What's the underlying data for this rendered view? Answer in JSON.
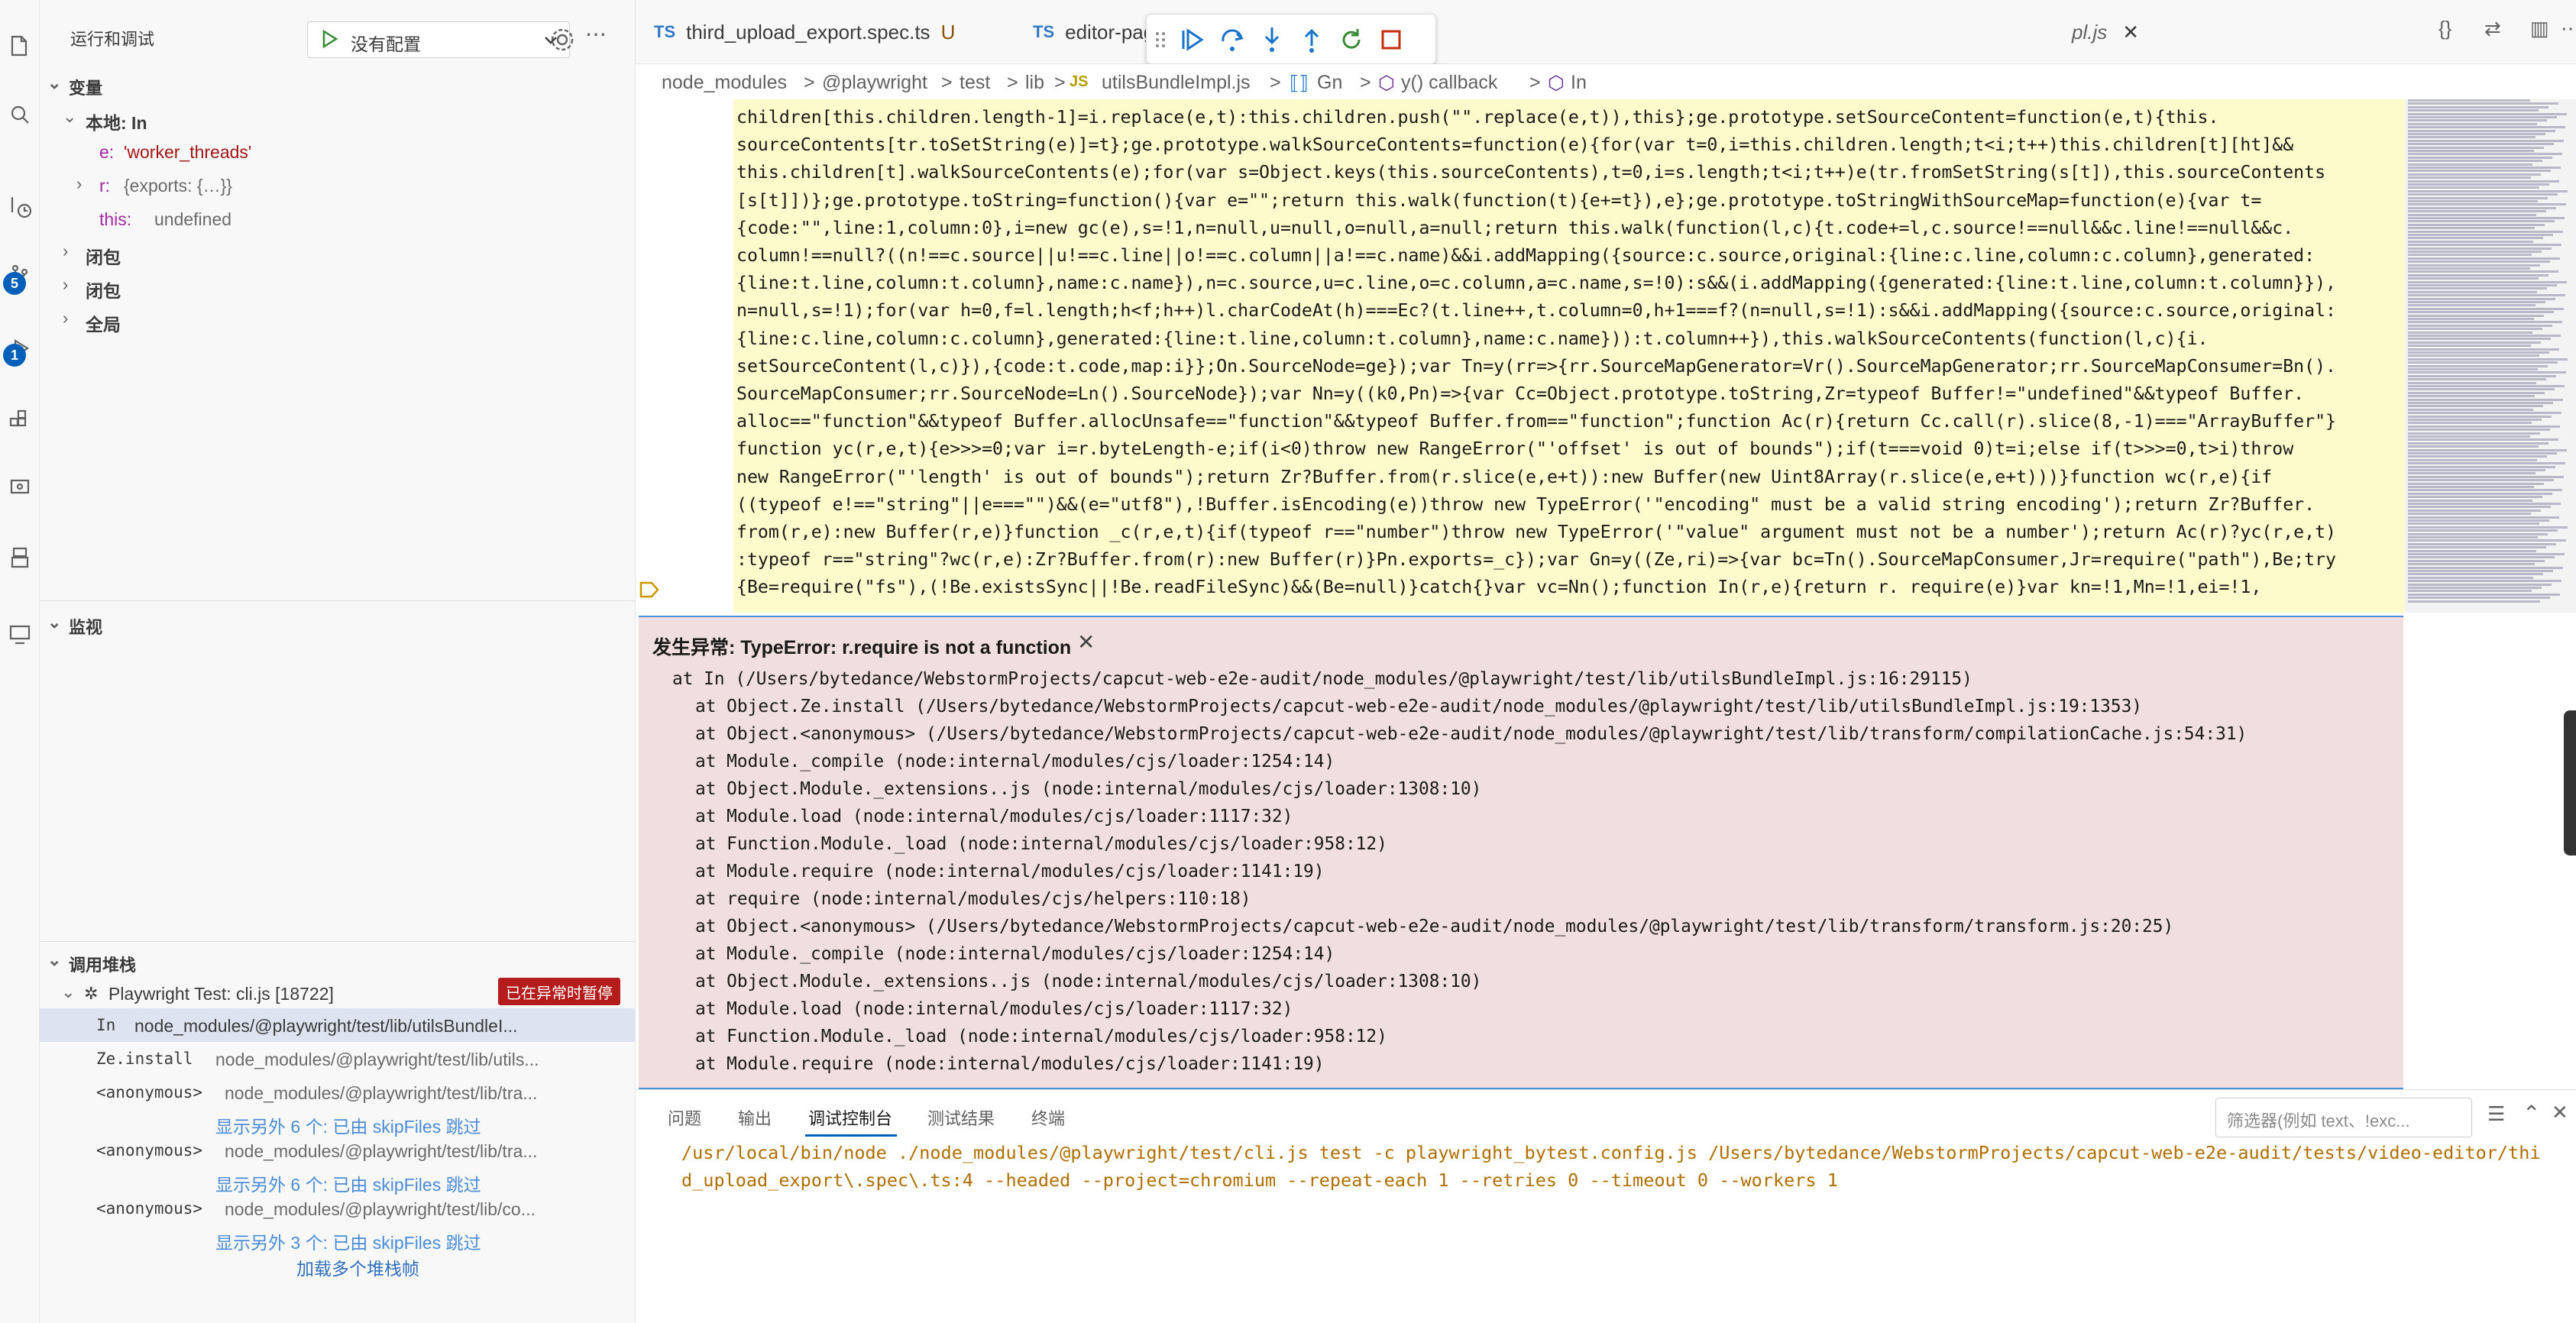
{
  "sidebar": {
    "title": "运行和调试",
    "run_config": "没有配置",
    "variables_header": "变量",
    "local_header": "本地: In",
    "vars": [
      {
        "name": "e:",
        "value": "'worker_threads'"
      },
      {
        "name": "r:",
        "value": "{exports: {…}}"
      },
      {
        "name": "this:",
        "value": "undefined"
      }
    ],
    "closure1": "闭包",
    "closure2": "闭包",
    "global": "全局",
    "watch_header": "监视",
    "callstack_header": "调用堆栈",
    "session": "Playwright Test: cli.js [18722]",
    "paused_badge": "已在异常时暂停",
    "frames": [
      {
        "fn": "In",
        "path": "node_modules/@playwright/test/lib/utilsBundleI..."
      },
      {
        "fn": "Ze.install",
        "path": "node_modules/@playwright/test/lib/utils..."
      },
      {
        "fn": "<anonymous>",
        "path": "node_modules/@playwright/test/lib/tra..."
      },
      {
        "skip": "显示另外 6 个: 已由 skipFiles 跳过"
      },
      {
        "fn": "<anonymous>",
        "path": "node_modules/@playwright/test/lib/tra..."
      },
      {
        "skip": "显示另外 6 个: 已由 skipFiles 跳过"
      },
      {
        "fn": "<anonymous>",
        "path": "node_modules/@playwright/test/lib/co..."
      },
      {
        "skip": "显示另外 3 个: 已由 skipFiles 跳过"
      }
    ],
    "load_more": "加载多个堆栈帧"
  },
  "tabs": [
    {
      "label": "third_upload_export.spec.ts",
      "mod": "U"
    },
    {
      "label": "editor-pag"
    },
    {
      "label": "pl.js"
    }
  ],
  "breadcrumb": [
    "node_modules",
    ">",
    "@playwright",
    ">",
    "test",
    ">",
    "lib",
    ">",
    "utilsBundleImpl.js",
    ">",
    "Gn",
    ">",
    "y() callback",
    ">",
    "In"
  ],
  "code_lines": [
    "children[this.children.length-1]=i.replace(e,t):this.children.push(\"\".replace(e,t)),this};ge.prototype.setSourceContent=function(e,t){this.",
    "sourceContents[tr.toSetString(e)]=t};ge.prototype.walkSourceContents=function(e){for(var t=0,i=this.children.length;t<i;t++)this.children[t][ht]&&",
    "this.children[t].walkSourceContents(e);for(var s=Object.keys(this.sourceContents),t=0,i=s.length;t<i;t++)e(tr.fromSetString(s[t]),this.sourceContents",
    "[s[t]])};ge.prototype.toString=function(){var e=\"\";return this.walk(function(t){e+=t}),e};ge.prototype.toStringWithSourceMap=function(e){var t=",
    "{code:\"\",line:1,column:0},i=new gc(e),s=!1,n=null,u=null,o=null,a=null;return this.walk(function(l,c){t.code+=l,c.source!==null&&c.line!==null&&c.",
    "column!==null?((n!==c.source||u!==c.line||o!==c.column||a!==c.name)&&i.addMapping({source:c.source,original:{line:c.line,column:c.column},generated:",
    "{line:t.line,column:t.column},name:c.name}),n=c.source,u=c.line,o=c.column,a=c.name,s=!0):s&&(i.addMapping({generated:{line:t.line,column:t.column}}),",
    "n=null,s=!1);for(var h=0,f=l.length;h<f;h++)l.charCodeAt(h)===Ec?(t.line++,t.column=0,h+1===f?(n=null,s=!1):s&&i.addMapping({source:c.source,original:",
    "{line:c.line,column:c.column},generated:{line:t.line,column:t.column},name:c.name})):t.column++}),this.walkSourceContents(function(l,c){i.",
    "setSourceContent(l,c)}),{code:t.code,map:i}};On.SourceNode=ge});var Tn=y(rr=>{rr.SourceMapGenerator=Vr().SourceMapGenerator;rr.SourceMapConsumer=Bn().",
    "SourceMapConsumer;rr.SourceNode=Ln().SourceNode});var Nn=y((k0,Pn)=>{var Cc=Object.prototype.toString,Zr=typeof Buffer!=\"undefined\"&&typeof Buffer.",
    "alloc==\"function\"&&typeof Buffer.allocUnsafe==\"function\"&&typeof Buffer.from==\"function\";function Ac(r){return Cc.call(r).slice(8,-1)===\"ArrayBuffer\"}",
    "function yc(r,e,t){e>>>=0;var i=r.byteLength-e;if(i<0)throw new RangeError(\"'offset' is out of bounds\");if(t===void 0)t=i;else if(t>>>=0,t>i)throw",
    "new RangeError(\"'length' is out of bounds\");return Zr?Buffer.from(r.slice(e,e+t)):new Buffer(new Uint8Array(r.slice(e,e+t)))}function wc(r,e){if",
    "((typeof e!==\"string\"||e===\"\")&&(e=\"utf8\"),!Buffer.isEncoding(e))throw new TypeError('\"encoding\" must be a valid string encoding');return Zr?Buffer.",
    "from(r,e):new Buffer(r,e)}function _c(r,e,t){if(typeof r==\"number\")throw new TypeError('\"value\" argument must not be a number');return Ac(r)?yc(r,e,t)",
    ":typeof r==\"string\"?wc(r,e):Zr?Buffer.from(r):new Buffer(r)}Pn.exports=_c});var Gn=y((Ze,ri)=>{var bc=Tn().SourceMapConsumer,Jr=require(\"path\"),Be;try",
    "{Be=require(\"fs\"),(!Be.existsSync||!Be.readFileSync)&&(Be=null)}catch{}var vc=Nn();function In(r,e){return r. require(e)}var kn=!1,Mn=!1,ei=!1,"
  ],
  "exception": {
    "title": "发生异常: TypeError: r.require is not a function",
    "stack": [
      "at In (/Users/bytedance/WebstormProjects/capcut-web-e2e-audit/node_modules/@playwright/test/lib/utilsBundleImpl.js:16:29115)",
      "at Object.Ze.install (/Users/bytedance/WebstormProjects/capcut-web-e2e-audit/node_modules/@playwright/test/lib/utilsBundleImpl.js:19:1353)",
      "at Object.<anonymous> (/Users/bytedance/WebstormProjects/capcut-web-e2e-audit/node_modules/@playwright/test/lib/transform/compilationCache.js:54:31)",
      "at Module._compile (node:internal/modules/cjs/loader:1254:14)",
      "at Object.Module._extensions..js (node:internal/modules/cjs/loader:1308:10)",
      "at Module.load (node:internal/modules/cjs/loader:1117:32)",
      "at Function.Module._load (node:internal/modules/cjs/loader:958:12)",
      "at Module.require (node:internal/modules/cjs/loader:1141:19)",
      "at require (node:internal/modules/cjs/helpers:110:18)",
      "at Object.<anonymous> (/Users/bytedance/WebstormProjects/capcut-web-e2e-audit/node_modules/@playwright/test/lib/transform/transform.js:20:25)",
      "at Module._compile (node:internal/modules/cjs/loader:1254:14)",
      "at Object.Module._extensions..js (node:internal/modules/cjs/loader:1308:10)",
      "at Module.load (node:internal/modules/cjs/loader:1117:32)",
      "at Function.Module._load (node:internal/modules/cjs/loader:958:12)",
      "at Module.require (node:internal/modules/cjs/loader:1141:19)"
    ]
  },
  "panel": {
    "tabs": [
      "问题",
      "输出",
      "调试控制台",
      "测试结果",
      "终端"
    ],
    "filter_placeholder": "筛选器(例如 text、!exc...",
    "console": [
      "/usr/local/bin/node ./node_modules/@playwright/test/cli.js test -c playwright_bytest.config.js /Users/bytedance/WebstormProjects/capcut-web-e2e-audit/tests/video-editor/thi",
      "d_upload_export\\.spec\\.ts:4 --headed --project=chromium --repeat-each 1 --retries 0 --timeout 0 --workers 1"
    ]
  },
  "badges": {
    "source_control": "5",
    "debug": "1"
  },
  "colors": {
    "accent": "#005fb8",
    "exception_bg": "#f1dfdf",
    "highlight_bg": "#fdfbcb",
    "paused_badge": "#b51c1c"
  }
}
